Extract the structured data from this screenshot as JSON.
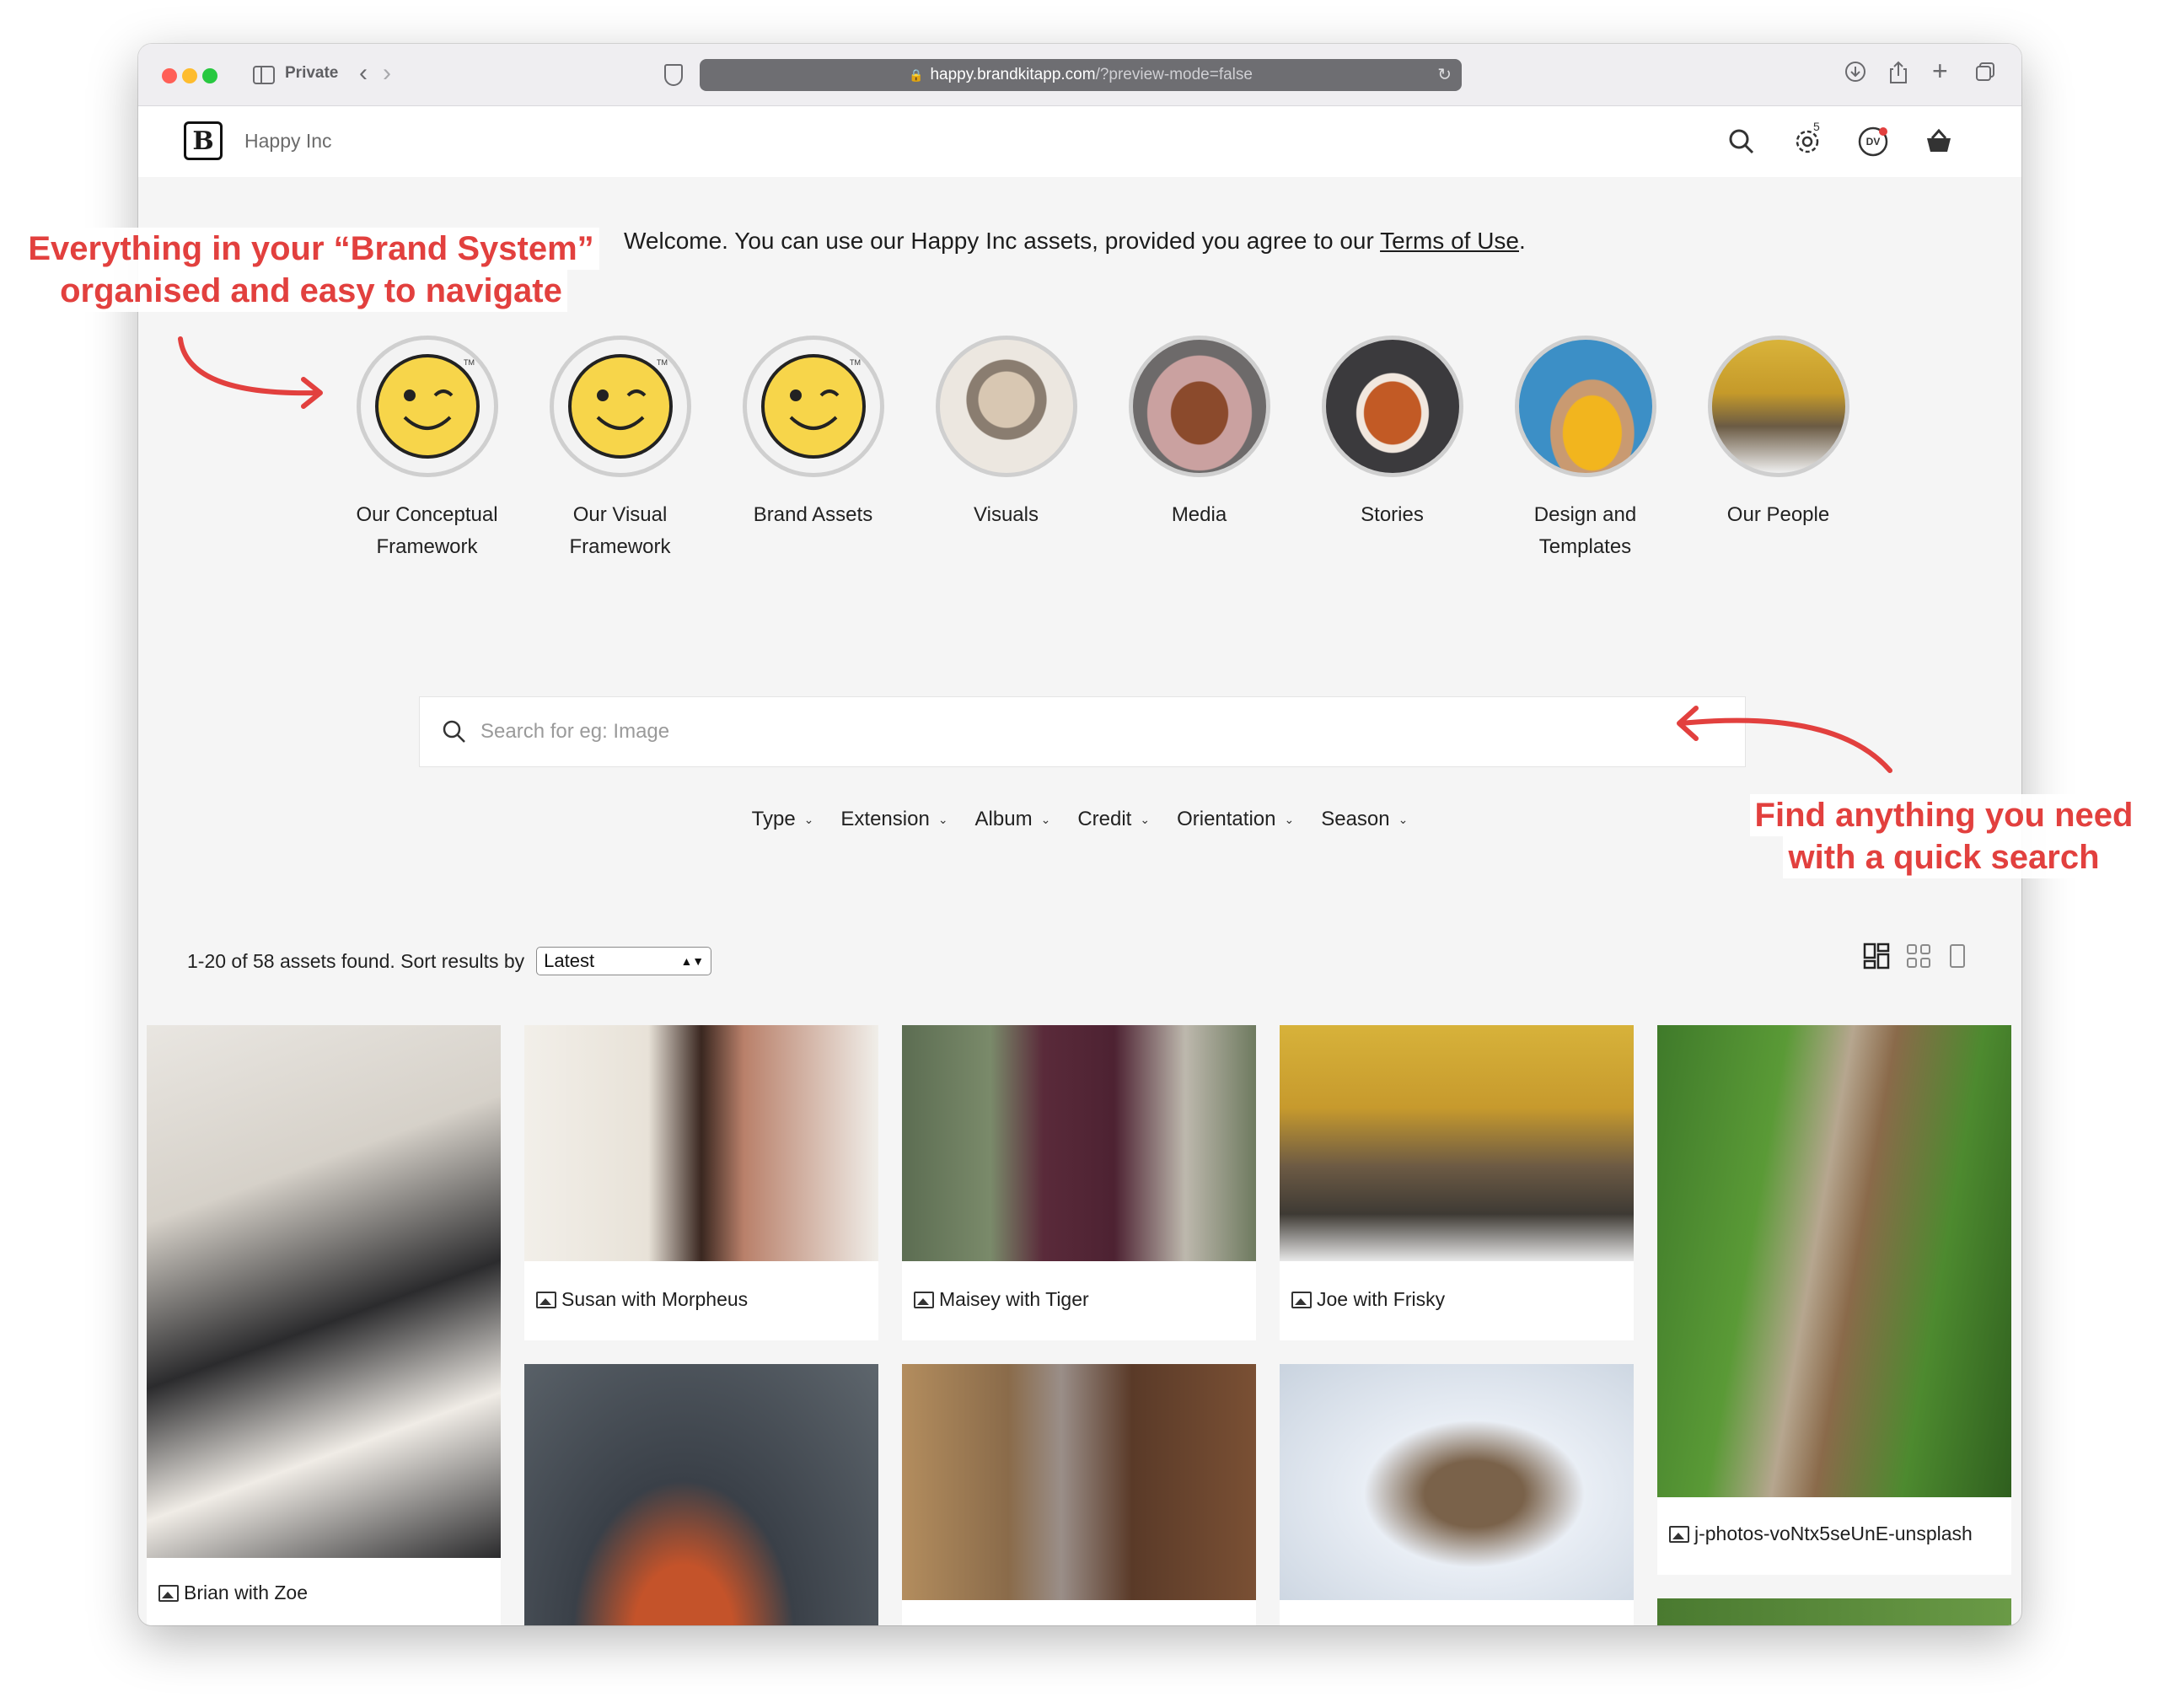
{
  "browser": {
    "private_label": "Private",
    "url_host": "happy.brandkitapp.com",
    "url_path": "/?preview-mode=false"
  },
  "header": {
    "brand_name": "Happy Inc",
    "avatar_initials": "DV",
    "cart_count": "5"
  },
  "welcome": {
    "text": "Welcome. You can use our Happy Inc assets, provided you agree to our ",
    "link": "Terms of Use",
    "end": "."
  },
  "categories": [
    {
      "label": "Our Conceptual Framework",
      "icon": "smiley-icon"
    },
    {
      "label": "Our Visual Framework",
      "icon": "smiley-icon"
    },
    {
      "label": "Brand Assets",
      "icon": "smiley-icon"
    },
    {
      "label": "Visuals",
      "icon": "kitten-photo"
    },
    {
      "label": "Media",
      "icon": "puppy-photo"
    },
    {
      "label": "Stories",
      "icon": "squirrel-photo"
    },
    {
      "label": "Design and Templates",
      "icon": "dog-photo"
    },
    {
      "label": "Our People",
      "icon": "person-photo"
    }
  ],
  "search": {
    "placeholder": "Search for eg: Image"
  },
  "filters": [
    "Type",
    "Extension",
    "Album",
    "Credit",
    "Orientation",
    "Season"
  ],
  "results": {
    "summary": "1-20 of 58 assets found. Sort results by",
    "sort_value": "Latest"
  },
  "assets": [
    {
      "caption": "Brian with Zoe"
    },
    {
      "caption": "Susan with Morpheus"
    },
    {
      "caption": "Maisey with Tiger"
    },
    {
      "caption": "Joe with Frisky"
    },
    {
      "caption": "j-photos-voNtx5seUnE-unsplash"
    }
  ],
  "callouts": {
    "left_line1": "Everything in your “Brand System”",
    "left_line2": "organised and easy to navigate",
    "right_line1": "Find anything you need",
    "right_line2": "with a quick search"
  },
  "colors": {
    "accent": "#e2403e",
    "smiley": "#f7d54a"
  }
}
